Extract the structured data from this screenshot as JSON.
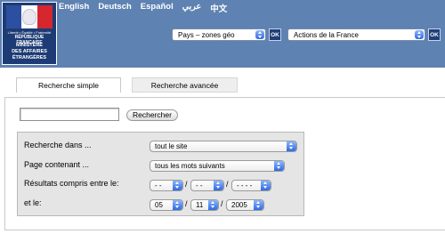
{
  "header": {
    "logo": {
      "motto": "Liberté • Égalité • Fraternité",
      "republic": "RÉPUBLIQUE FRANÇAISE",
      "ministry_line1": "MINISTÈRE",
      "ministry_line2": "DES AFFAIRES",
      "ministry_line3": "ÉTRANGÈRES"
    },
    "languages": [
      "English",
      "Deutsch",
      "Español",
      "عربي",
      "中文"
    ],
    "zone_select": "Pays – zones géo",
    "action_select": "Actions de la France",
    "ok_label": "OK"
  },
  "tabs": {
    "simple": "Recherche simple",
    "advanced": "Recherche avancée"
  },
  "search": {
    "input_value": "",
    "button_label": "Rechercher"
  },
  "criteria": {
    "search_in_label": "Recherche dans ...",
    "search_in_value": "tout le site",
    "page_contains_label": "Page contenant ...",
    "page_contains_value": "tous les mots suivants",
    "results_between_label": "Résultats compris entre le:",
    "from_day": "- -",
    "from_month": "- -",
    "from_year": "- - - -",
    "and_label": "et le:",
    "to_day": "05",
    "to_month": "11",
    "to_year": "2005",
    "separator": "/"
  }
}
